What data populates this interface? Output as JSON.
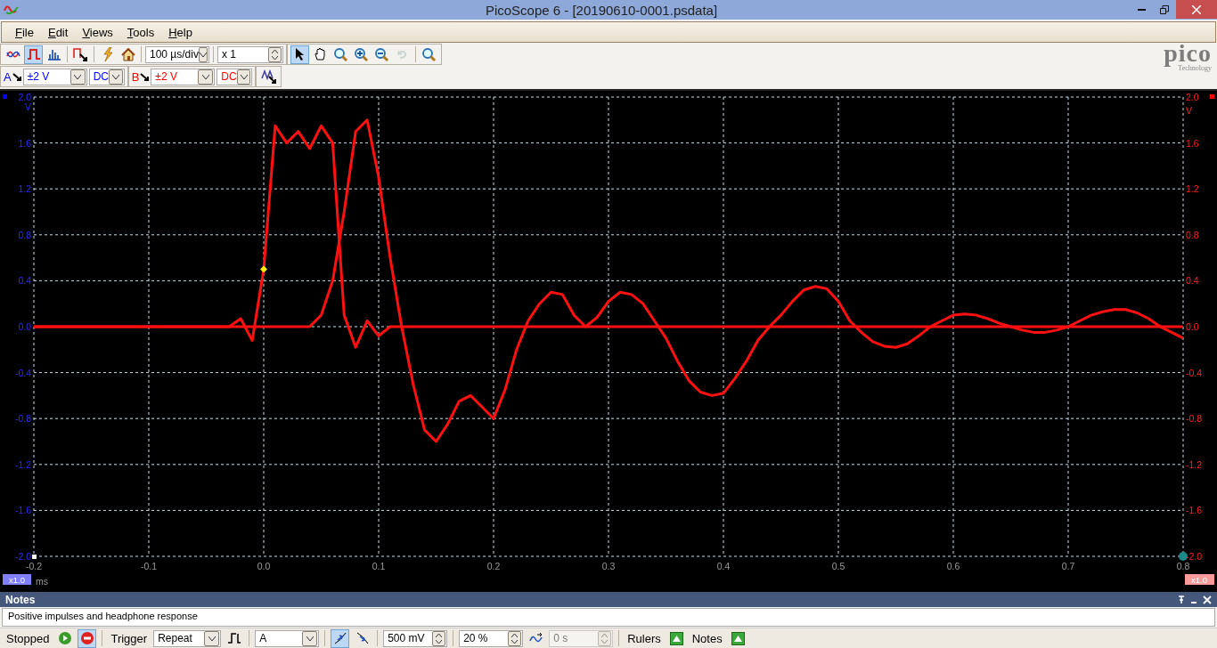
{
  "window": {
    "title": "PicoScope 6 - [20190610-0001.psdata]"
  },
  "menu": [
    "File",
    "Edit",
    "Views",
    "Tools",
    "Help"
  ],
  "toolbar": {
    "modes": [
      {
        "kind": "scope",
        "selected": false
      },
      {
        "kind": "persistence",
        "selected": true
      },
      {
        "kind": "spectrum",
        "selected": false
      }
    ],
    "timebase": "100 µs/div",
    "zoom": "x 1",
    "tools": [
      {
        "kind": "pointer",
        "selected": true,
        "disabled": false
      },
      {
        "kind": "hand",
        "selected": false,
        "disabled": false
      },
      {
        "kind": "zoom-box",
        "selected": false,
        "disabled": false
      },
      {
        "kind": "zoom-in",
        "selected": false,
        "disabled": false
      },
      {
        "kind": "zoom-out",
        "selected": false,
        "disabled": false
      },
      {
        "kind": "undo-zoom",
        "selected": false,
        "disabled": true
      }
    ]
  },
  "logo": {
    "name": "pico",
    "tagline": "Technology"
  },
  "channels": [
    {
      "label": "A",
      "range": "±2 V",
      "coupling": "DC",
      "color": "#0000ff"
    },
    {
      "label": "B",
      "range": "±2 V",
      "coupling": "DC",
      "color": "#ff0000"
    }
  ],
  "plot": {
    "chart_data": {
      "type": "line",
      "grid": true,
      "xlabel": "ms",
      "ylabel": "V",
      "xlim": [
        -0.2,
        0.8
      ],
      "ylim": [
        -2,
        2
      ],
      "xticks": [
        {
          "value": -0.2,
          "label": "-0.2"
        },
        {
          "value": -0.1,
          "label": "-0.1"
        },
        {
          "value": 0,
          "label": "0.0"
        },
        {
          "value": 0.1,
          "label": "0.1"
        },
        {
          "value": 0.2,
          "label": "0.2"
        },
        {
          "value": 0.3,
          "label": "0.3"
        },
        {
          "value": 0.4,
          "label": "0.4"
        },
        {
          "value": 0.5,
          "label": "0.5"
        },
        {
          "value": 0.6,
          "label": "0.6"
        },
        {
          "value": 0.7,
          "label": "0.7"
        },
        {
          "value": 0.8,
          "label": "0.8"
        }
      ],
      "yticks": [
        {
          "value": 2,
          "label": "2.0"
        },
        {
          "value": 1.6,
          "label": "1.6"
        },
        {
          "value": 1.2,
          "label": "1.2"
        },
        {
          "value": 0.8,
          "label": "0.8"
        },
        {
          "value": 0.4,
          "label": "0.4"
        },
        {
          "value": 0,
          "label": "0.0"
        },
        {
          "value": -0.4,
          "label": "-0.4"
        },
        {
          "value": -0.8,
          "label": "-0.8"
        },
        {
          "value": -1.2,
          "label": "-1.2"
        },
        {
          "value": -1.6,
          "label": "-1.6"
        },
        {
          "value": -2,
          "label": "-2.0"
        }
      ],
      "x": [
        -0.2,
        -0.19,
        -0.18,
        -0.17,
        -0.16,
        -0.15,
        -0.14,
        -0.13,
        -0.12,
        -0.11,
        -0.1,
        -0.09,
        -0.08,
        -0.07,
        -0.06,
        -0.05,
        -0.04,
        -0.03,
        -0.02,
        -0.01,
        0,
        0.01,
        0.02,
        0.03,
        0.04,
        0.05,
        0.06,
        0.07,
        0.08,
        0.09,
        0.1,
        0.11,
        0.12,
        0.13,
        0.14,
        0.15,
        0.16,
        0.17,
        0.18,
        0.19,
        0.2,
        0.21,
        0.22,
        0.23,
        0.24,
        0.25,
        0.26,
        0.27,
        0.28,
        0.29,
        0.3,
        0.31,
        0.32,
        0.33,
        0.34,
        0.35,
        0.36,
        0.37,
        0.38,
        0.39,
        0.4,
        0.41,
        0.42,
        0.43,
        0.44,
        0.45,
        0.46,
        0.47,
        0.48,
        0.49,
        0.5,
        0.51,
        0.52,
        0.53,
        0.54,
        0.55,
        0.56,
        0.57,
        0.58,
        0.59,
        0.6,
        0.61,
        0.62,
        0.63,
        0.64,
        0.65,
        0.66,
        0.67,
        0.68,
        0.69,
        0.7,
        0.71,
        0.72,
        0.73,
        0.74,
        0.75,
        0.76,
        0.77,
        0.78,
        0.79,
        0.8
      ],
      "series": [
        {
          "color": "#ff1010",
          "values": [
            0,
            0,
            0,
            0,
            0,
            0,
            0,
            0,
            0,
            0,
            0,
            0,
            0,
            0,
            0,
            0,
            0,
            0,
            0.07,
            -0.12,
            0.5,
            1.75,
            1.6,
            1.7,
            1.55,
            1.75,
            1.6,
            0.1,
            -0.18,
            0.05,
            -0.08,
            0,
            0,
            0,
            0,
            0,
            0,
            0,
            0,
            0,
            0,
            0,
            0,
            0,
            0,
            0,
            0,
            0,
            0,
            0,
            0,
            0,
            0,
            0,
            0,
            0,
            0,
            0,
            0,
            0,
            0,
            0,
            0,
            0,
            0,
            0,
            0,
            0,
            0,
            0,
            0,
            0,
            0,
            0,
            0,
            0,
            0,
            0,
            0,
            0,
            0,
            0,
            0,
            0,
            0,
            0,
            0,
            0,
            0,
            0,
            0,
            0,
            0,
            0,
            0,
            0,
            0,
            0,
            0,
            0,
            0
          ]
        },
        {
          "color": "#ff1010",
          "values": [
            0,
            0,
            0,
            0,
            0,
            0,
            0,
            0,
            0,
            0,
            0,
            0,
            0,
            0,
            0,
            0,
            0,
            0,
            0,
            0,
            0,
            0,
            0,
            0,
            0,
            0.1,
            0.4,
            1.0,
            1.7,
            1.8,
            1.3,
            0.6,
            0,
            -0.5,
            -0.9,
            -1.0,
            -0.85,
            -0.65,
            -0.6,
            -0.7,
            -0.8,
            -0.55,
            -0.2,
            0.05,
            0.2,
            0.3,
            0.28,
            0.1,
            0,
            0.08,
            0.22,
            0.3,
            0.28,
            0.2,
            0.05,
            -0.1,
            -0.3,
            -0.47,
            -0.57,
            -0.6,
            -0.58,
            -0.45,
            -0.3,
            -0.12,
            0,
            0.1,
            0.22,
            0.32,
            0.35,
            0.33,
            0.22,
            0.05,
            -0.05,
            -0.13,
            -0.17,
            -0.18,
            -0.15,
            -0.08,
            0,
            0.05,
            0.1,
            0.11,
            0.1,
            0.07,
            0.03,
            0,
            -0.03,
            -0.05,
            -0.05,
            -0.03,
            0,
            0.05,
            0.1,
            0.13,
            0.15,
            0.15,
            0.12,
            0.07,
            0,
            -0.05,
            -0.1
          ]
        }
      ]
    },
    "right_ticks": [
      "2.0",
      "1.6",
      "1.2",
      "0.8",
      "0.4",
      "0.0",
      "-0.4",
      "-0.8",
      "-1.2",
      "-1.6",
      "-2.0"
    ],
    "right_unit": "V",
    "left_scale": "x1.0",
    "right_scale": "x1.0"
  },
  "notes": {
    "title": "Notes",
    "text": "Positive impulses and headphone response"
  },
  "status": {
    "state": "Stopped",
    "trigger_label": "Trigger",
    "trigger_mode": "Repeat",
    "trigger_source": "A",
    "edges": [
      {
        "kind": "rising",
        "selected": true
      },
      {
        "kind": "falling",
        "selected": false
      }
    ],
    "threshold": "500 mV",
    "pretrigger": "20 %",
    "delay": "0 s",
    "delay_disabled": true,
    "rulers": "Rulers",
    "notes_button": "Notes"
  }
}
